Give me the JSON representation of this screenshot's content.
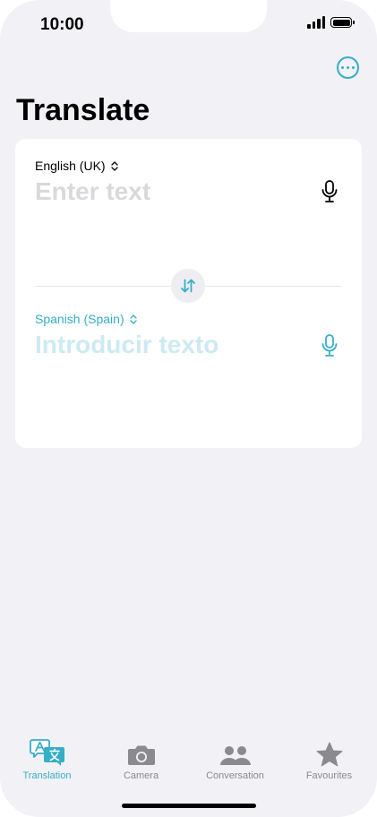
{
  "status": {
    "time": "10:00"
  },
  "header": {
    "title": "Translate",
    "more_icon": "ellipsis-circle-icon"
  },
  "source": {
    "language": "English (UK)",
    "placeholder": "Enter text"
  },
  "target": {
    "language": "Spanish (Spain)",
    "placeholder": "Introducir texto"
  },
  "tabs": [
    {
      "label": "Translation",
      "icon": "translate-icon",
      "active": true
    },
    {
      "label": "Camera",
      "icon": "camera-icon",
      "active": false
    },
    {
      "label": "Conversation",
      "icon": "people-icon",
      "active": false
    },
    {
      "label": "Favourites",
      "icon": "star-icon",
      "active": false
    }
  ],
  "colors": {
    "accent": "#35aec6",
    "background": "#f2f1f6",
    "inactive": "#8a8a8f"
  }
}
